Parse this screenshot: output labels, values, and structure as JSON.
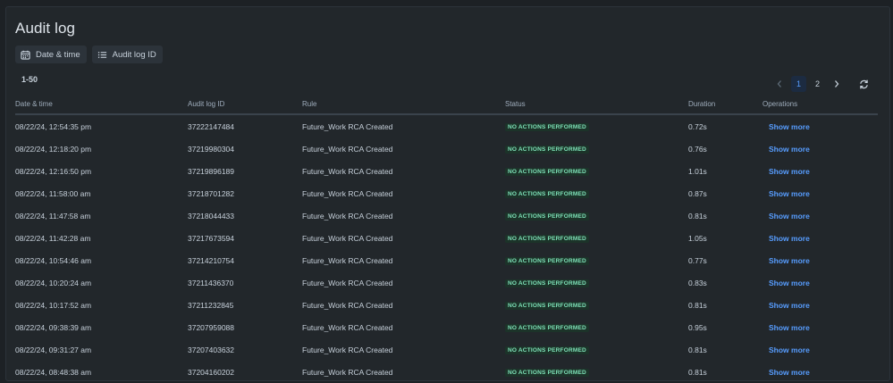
{
  "page": {
    "title": "Audit log"
  },
  "filters": [
    {
      "label": "Date & time",
      "icon": "calendar-icon"
    },
    {
      "label": "Audit log ID",
      "icon": "list-icon"
    }
  ],
  "range_label": "1-50",
  "pagination": {
    "pages": [
      "1",
      "2"
    ],
    "current": "1"
  },
  "table": {
    "headers": [
      "Date & time",
      "Audit log ID",
      "Rule",
      "Status",
      "Duration",
      "Operations"
    ],
    "rows": [
      {
        "datetime": "08/22/24, 12:54:35 pm",
        "id": "37222147484",
        "rule": "Future_Work RCA Created",
        "status": "NO ACTIONS PERFORMED",
        "duration": "0.72s",
        "op": "Show more"
      },
      {
        "datetime": "08/22/24, 12:18:20 pm",
        "id": "37219980304",
        "rule": "Future_Work RCA Created",
        "status": "NO ACTIONS PERFORMED",
        "duration": "0.76s",
        "op": "Show more"
      },
      {
        "datetime": "08/22/24, 12:16:50 pm",
        "id": "37219896189",
        "rule": "Future_Work RCA Created",
        "status": "NO ACTIONS PERFORMED",
        "duration": "1.01s",
        "op": "Show more"
      },
      {
        "datetime": "08/22/24, 11:58:00 am",
        "id": "37218701282",
        "rule": "Future_Work RCA Created",
        "status": "NO ACTIONS PERFORMED",
        "duration": "0.87s",
        "op": "Show more"
      },
      {
        "datetime": "08/22/24, 11:47:58 am",
        "id": "37218044433",
        "rule": "Future_Work RCA Created",
        "status": "NO ACTIONS PERFORMED",
        "duration": "0.81s",
        "op": "Show more"
      },
      {
        "datetime": "08/22/24, 11:42:28 am",
        "id": "37217673594",
        "rule": "Future_Work RCA Created",
        "status": "NO ACTIONS PERFORMED",
        "duration": "1.05s",
        "op": "Show more"
      },
      {
        "datetime": "08/22/24, 10:54:46 am",
        "id": "37214210754",
        "rule": "Future_Work RCA Created",
        "status": "NO ACTIONS PERFORMED",
        "duration": "0.77s",
        "op": "Show more"
      },
      {
        "datetime": "08/22/24, 10:20:24 am",
        "id": "37211436370",
        "rule": "Future_Work RCA Created",
        "status": "NO ACTIONS PERFORMED",
        "duration": "0.83s",
        "op": "Show more"
      },
      {
        "datetime": "08/22/24, 10:17:52 am",
        "id": "37211232845",
        "rule": "Future_Work RCA Created",
        "status": "NO ACTIONS PERFORMED",
        "duration": "0.81s",
        "op": "Show more"
      },
      {
        "datetime": "08/22/24, 09:38:39 am",
        "id": "37207959088",
        "rule": "Future_Work RCA Created",
        "status": "NO ACTIONS PERFORMED",
        "duration": "0.95s",
        "op": "Show more"
      },
      {
        "datetime": "08/22/24, 09:31:27 am",
        "id": "37207403632",
        "rule": "Future_Work RCA Created",
        "status": "NO ACTIONS PERFORMED",
        "duration": "0.81s",
        "op": "Show more"
      },
      {
        "datetime": "08/22/24, 08:48:38 am",
        "id": "37204160202",
        "rule": "Future_Work RCA Created",
        "status": "NO ACTIONS PERFORMED",
        "duration": "0.81s",
        "op": "Show more"
      }
    ]
  },
  "colors": {
    "background": "#22272b",
    "accent": "#579dff",
    "status_bg": "#1c3329",
    "status_text": "#7ee2b8"
  }
}
